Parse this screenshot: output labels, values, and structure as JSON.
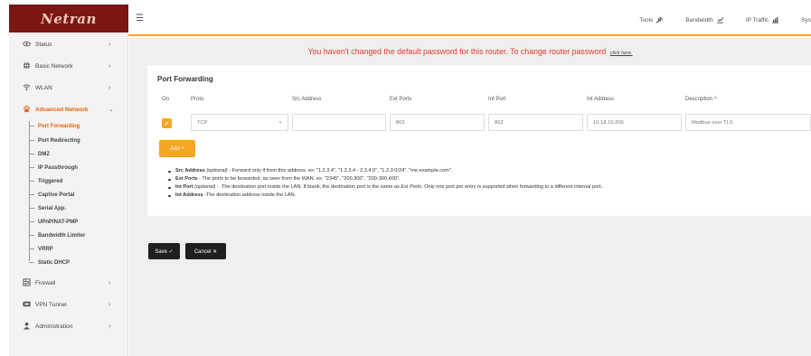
{
  "brand": {
    "logo_text": "Netran"
  },
  "topbar": {
    "menu_icon": "hamburger-icon",
    "items": [
      {
        "label": "Tools",
        "icon": "tools-icon"
      },
      {
        "label": "Bandwidth",
        "icon": "bandwidth-chart-icon"
      },
      {
        "label": "IP Traffic",
        "icon": "traffic-chart-icon"
      },
      {
        "label": "Sys"
      }
    ]
  },
  "sidebar": {
    "items": [
      {
        "label": "Status",
        "icon": "eye-icon",
        "arrow": "›"
      },
      {
        "label": "Basic Network",
        "icon": "globe-icon",
        "arrow": "›"
      },
      {
        "label": "WLAN",
        "icon": "wifi-icon",
        "arrow": "›"
      },
      {
        "label": "Advanced Network",
        "icon": "network-icon",
        "arrow": "⌄"
      },
      {
        "label": "Firewall",
        "icon": "firewall-icon",
        "arrow": "›"
      },
      {
        "label": "VPN Tunnel",
        "icon": "vpn-icon",
        "arrow": "›"
      },
      {
        "label": "Administration",
        "icon": "admin-icon",
        "arrow": "›"
      }
    ],
    "sub_items": [
      "Port Forwarding",
      "Port Redirecting",
      "DMZ",
      "IP Passthrough",
      "Triggered",
      "Captive Portal",
      "Serial App.",
      "UPnP/NAT-PMP",
      "Bandwidth Limiter",
      "VRRP",
      "Static DHCP"
    ]
  },
  "alert": {
    "text": "You haven't changed the default password for this router. To change router password",
    "link": "click here."
  },
  "card": {
    "title": "Port Forwarding",
    "columns": [
      "On",
      "Proto",
      "Src Address",
      "Ext Ports",
      "Int Port",
      "Int Address",
      "Description"
    ],
    "sort_indicator": "^",
    "row": {
      "on": true,
      "check_mark": "✓",
      "proto": "TCP",
      "proto_caret": "⌄",
      "src_address": "",
      "ext_ports": "802",
      "int_port": "802",
      "int_address": "10.18.10.206",
      "description": "Modbus over TLS"
    },
    "add_button": "Add +",
    "notes": [
      {
        "term": "Src Address",
        "qualifier": "(optional)",
        "text": " - Forward only if from this address. ex: \"1.2.3.4\", \"1.2.3.4 - 2.3.4.5\", \"1.2.3.0/24\", \"me.example.com\"."
      },
      {
        "term": "Ext Ports",
        "qualifier": "",
        "text": " - The ports to be forwarded, as seen from the WAN. ex: \"2345\", \"200,300\", \"200-300,400\"."
      },
      {
        "term": "Int Port",
        "qualifier": "(optional)",
        "text": " - .The destination port inside the LAN. If blank, the destination port is the same as ",
        "italic": "Ext Ports",
        "text2": ". Only one port per entry is supported when forwarding to a different internal port.."
      },
      {
        "term": "Int Address",
        "qualifier": "",
        "text": " -The destination address inside the LAN."
      }
    ]
  },
  "actions": {
    "save": "Save ✓",
    "cancel": "Cancel ✕"
  },
  "colors": {
    "accent": "#f5a623",
    "brand": "#7a1712",
    "alert": "#e23a2b",
    "active": "#e8630a"
  }
}
